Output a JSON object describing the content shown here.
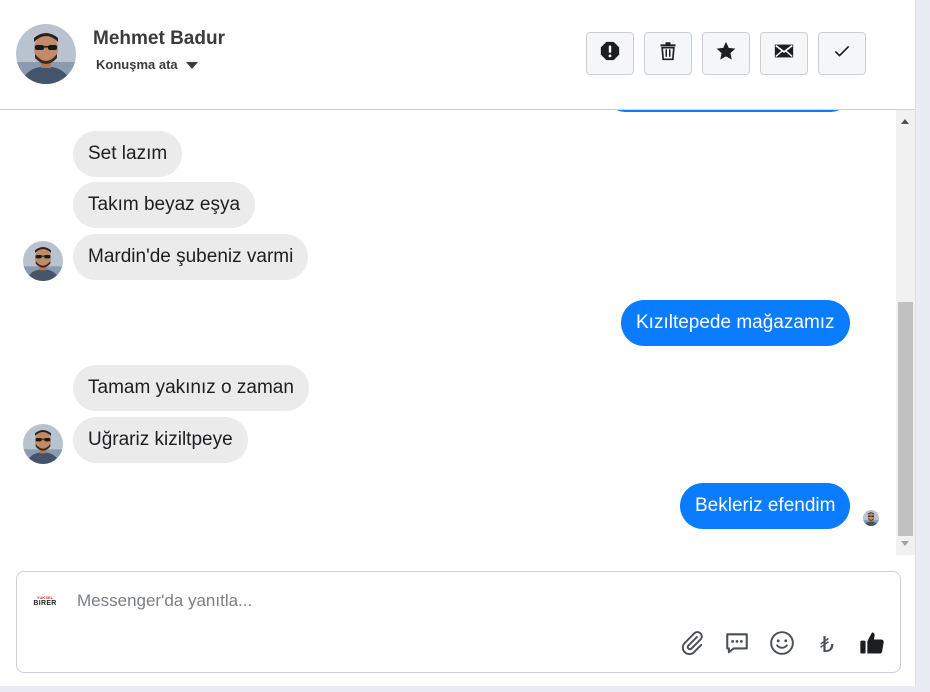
{
  "header": {
    "contact_name": "Mehmet Badur",
    "assign_label": "Konuşma ata",
    "actions": [
      "spam-alert",
      "delete",
      "star",
      "mark-unread",
      "done"
    ]
  },
  "messages": [
    {
      "direction": "in",
      "text": "Set lazım"
    },
    {
      "direction": "in",
      "text": "Takım beyaz eşya"
    },
    {
      "direction": "in",
      "text": "Mardin'de şubeniz varmi"
    },
    {
      "direction": "out",
      "text": "Kızıltepede mağazamız"
    },
    {
      "direction": "in",
      "text": "Tamam yakınız o zaman"
    },
    {
      "direction": "in",
      "text": "Uğrariz kiziltpeye"
    },
    {
      "direction": "out",
      "text": "Bekleriz efendim"
    }
  ],
  "composer": {
    "placeholder": "Messenger'da yanıtla...",
    "page_logo": {
      "top_text": "YUKSEL",
      "main_text": "BIRER"
    },
    "tools": [
      "paperclip-icon",
      "chat-bubble-icon",
      "smiley-icon",
      "lira-icon",
      "thumbs-up-icon"
    ],
    "lira_glyph": "₺"
  },
  "colors": {
    "outgoing_bubble": "#0a7cff",
    "incoming_bubble": "#ebebeb",
    "scrollbar_thumb": "#c1c1c1"
  }
}
